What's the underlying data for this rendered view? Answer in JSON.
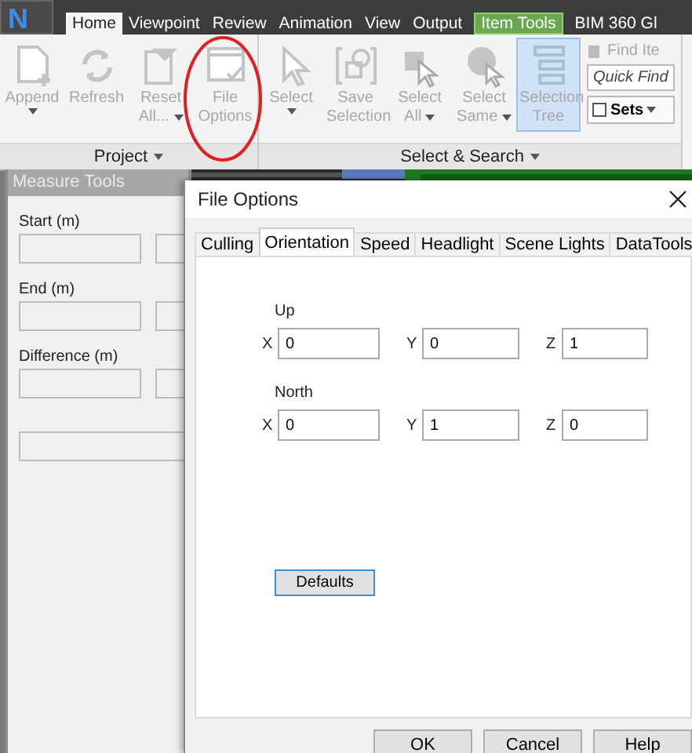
{
  "app_menu": {
    "label": "N"
  },
  "ribbon_tabs": [
    {
      "label": "Home",
      "selected": true,
      "kind": "normal"
    },
    {
      "label": "Viewpoint",
      "selected": false,
      "kind": "normal"
    },
    {
      "label": "Review",
      "selected": false,
      "kind": "normal"
    },
    {
      "label": "Animation",
      "selected": false,
      "kind": "normal"
    },
    {
      "label": "View",
      "selected": false,
      "kind": "normal"
    },
    {
      "label": "Output",
      "selected": false,
      "kind": "normal"
    },
    {
      "label": "Item Tools",
      "selected": false,
      "kind": "contextual"
    },
    {
      "label": "BIM 360 Gl",
      "selected": false,
      "kind": "normal"
    }
  ],
  "ribbon_groups": [
    {
      "label": "Project",
      "items": [
        {
          "label": "Append",
          "kind": "menu",
          "disabled": true,
          "selected": false,
          "circled": false
        },
        {
          "label": "Refresh",
          "kind": "plain",
          "disabled": true,
          "selected": false,
          "circled": false
        },
        {
          "label": "Reset All...",
          "kind": "split",
          "disabled": true,
          "selected": false,
          "circled": false
        },
        {
          "label": "File Options",
          "kind": "plain",
          "disabled": true,
          "selected": false,
          "circled": true
        }
      ]
    },
    {
      "label": "Select & Search",
      "items": [
        {
          "label": "Select",
          "kind": "menu",
          "disabled": true,
          "selected": false,
          "circled": false
        },
        {
          "label": "Save Selection",
          "kind": "plain",
          "disabled": true,
          "selected": false,
          "circled": false
        },
        {
          "label": "Select All",
          "kind": "split",
          "disabled": true,
          "selected": false,
          "circled": false
        },
        {
          "label": "Select Same",
          "kind": "split",
          "disabled": true,
          "selected": false,
          "circled": false
        },
        {
          "label": "Selection Tree",
          "kind": "plain",
          "disabled": true,
          "selected": true,
          "circled": false
        }
      ],
      "side": {
        "find": "Find Ite",
        "quick_find": {
          "placeholder": "Quick Find"
        },
        "sets": "Sets"
      }
    }
  ],
  "measure_tools": {
    "title": "Measure Tools",
    "rows": [
      {
        "label": "Start (m)"
      },
      {
        "label": "End (m)"
      },
      {
        "label": "Difference (m)"
      }
    ]
  },
  "dialog": {
    "title": "File Options",
    "tabs": [
      {
        "label": "Culling",
        "selected": false
      },
      {
        "label": "Orientation",
        "selected": true
      },
      {
        "label": "Speed",
        "selected": false
      },
      {
        "label": "Headlight",
        "selected": false
      },
      {
        "label": "Scene Lights",
        "selected": false
      },
      {
        "label": "DataTools",
        "selected": false
      }
    ],
    "groups": [
      {
        "label": "Up",
        "fields": [
          {
            "label": "X",
            "value": "0"
          },
          {
            "label": "Y",
            "value": "0"
          },
          {
            "label": "Z",
            "value": "1"
          }
        ]
      },
      {
        "label": "North",
        "fields": [
          {
            "label": "X",
            "value": "0"
          },
          {
            "label": "Y",
            "value": "1"
          },
          {
            "label": "Z",
            "value": "0"
          }
        ]
      }
    ],
    "defaults_button": "Defaults",
    "buttons": [
      "OK",
      "Cancel",
      "Help"
    ]
  }
}
